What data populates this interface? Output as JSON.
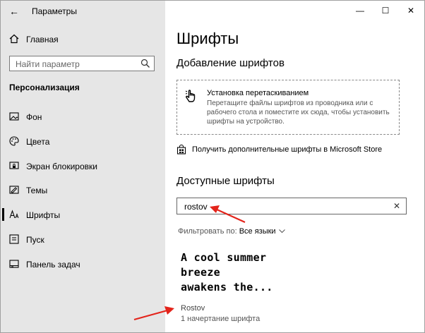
{
  "window": {
    "title": "Параметры",
    "controls": {
      "minimize": "—",
      "maximize": "☐",
      "close": "✕"
    }
  },
  "sidebar": {
    "home_label": "Главная",
    "search_placeholder": "Найти параметр",
    "section_title": "Персонализация",
    "items": [
      {
        "label": "Фон",
        "icon": "image-icon"
      },
      {
        "label": "Цвета",
        "icon": "palette-icon"
      },
      {
        "label": "Экран блокировки",
        "icon": "lock-screen-icon"
      },
      {
        "label": "Темы",
        "icon": "themes-icon"
      },
      {
        "label": "Шрифты",
        "icon": "font-icon",
        "active": true
      },
      {
        "label": "Пуск",
        "icon": "start-icon"
      },
      {
        "label": "Панель задач",
        "icon": "taskbar-icon"
      }
    ]
  },
  "main": {
    "title": "Шрифты",
    "add_heading": "Добавление шрифтов",
    "drop_title": "Установка перетаскиванием",
    "drop_desc": "Перетащите файлы шрифтов из проводника или с рабочего стола и поместите их сюда, чтобы установить шрифты на устройство.",
    "store_link": "Получить дополнительные шрифты в Microsoft Store",
    "available_heading": "Доступные шрифты",
    "search_value": "rostov",
    "filter_label": "Фильтровать по:",
    "filter_value": "Все языки",
    "font_card": {
      "preview_lines": [
        "A cool summer",
        "breeze",
        "awakens the..."
      ],
      "name": "Rostov",
      "count": "1 начертание шрифта"
    }
  },
  "colors": {
    "sidebar_bg": "#e6e6e6",
    "annotation_arrow": "#e3241b"
  }
}
